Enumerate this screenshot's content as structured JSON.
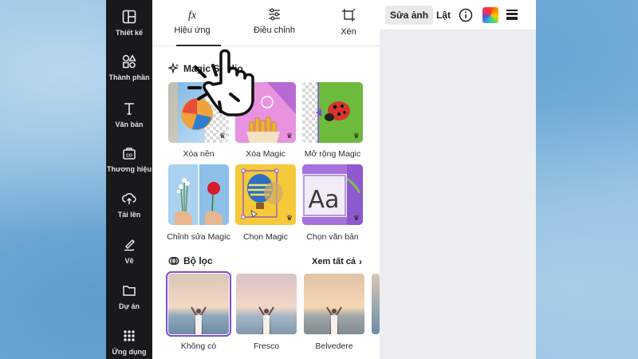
{
  "sidebar": {
    "items": [
      {
        "label": "Thiết kế",
        "icon": "layout-icon"
      },
      {
        "label": "Thành phần",
        "icon": "shapes-icon"
      },
      {
        "label": "Văn bản",
        "icon": "text-icon"
      },
      {
        "label": "Thương hiệu",
        "icon": "brand-icon"
      },
      {
        "label": "Tải lên",
        "icon": "upload-icon"
      },
      {
        "label": "Vẽ",
        "icon": "draw-icon"
      },
      {
        "label": "Dự án",
        "icon": "folder-icon"
      },
      {
        "label": "Ứng dụng",
        "icon": "apps-grid-icon"
      }
    ]
  },
  "tabs": [
    {
      "label": "Hiệu ứng",
      "icon": "fx-icon",
      "active": true
    },
    {
      "label": "Điều chỉnh",
      "icon": "sliders-icon"
    },
    {
      "label": "Xén",
      "icon": "crop-icon"
    }
  ],
  "magic": {
    "title": "Magic Studio",
    "items": [
      {
        "label": "Xóa nền",
        "premium": true
      },
      {
        "label": "Xóa Magic",
        "premium": true
      },
      {
        "label": "Mở rộng Magic",
        "premium": true
      },
      {
        "label": "Chỉnh sửa Magic",
        "premium": false
      },
      {
        "label": "Chọn Magic",
        "premium": true
      },
      {
        "label": "Chọn văn bản",
        "premium": true
      }
    ],
    "sample_text": "Aa"
  },
  "filters": {
    "title": "Bộ lọc",
    "see_all": "Xem tất cả",
    "items": [
      {
        "label": "Không có",
        "selected": true
      },
      {
        "label": "Fresco"
      },
      {
        "label": "Belvedere"
      }
    ]
  },
  "toolbar": {
    "edit_photo": "Sửa ảnh",
    "flip": "Lật"
  },
  "colors": {
    "sidebar_bg": "#18191b",
    "accent": "#7c4dd6"
  }
}
